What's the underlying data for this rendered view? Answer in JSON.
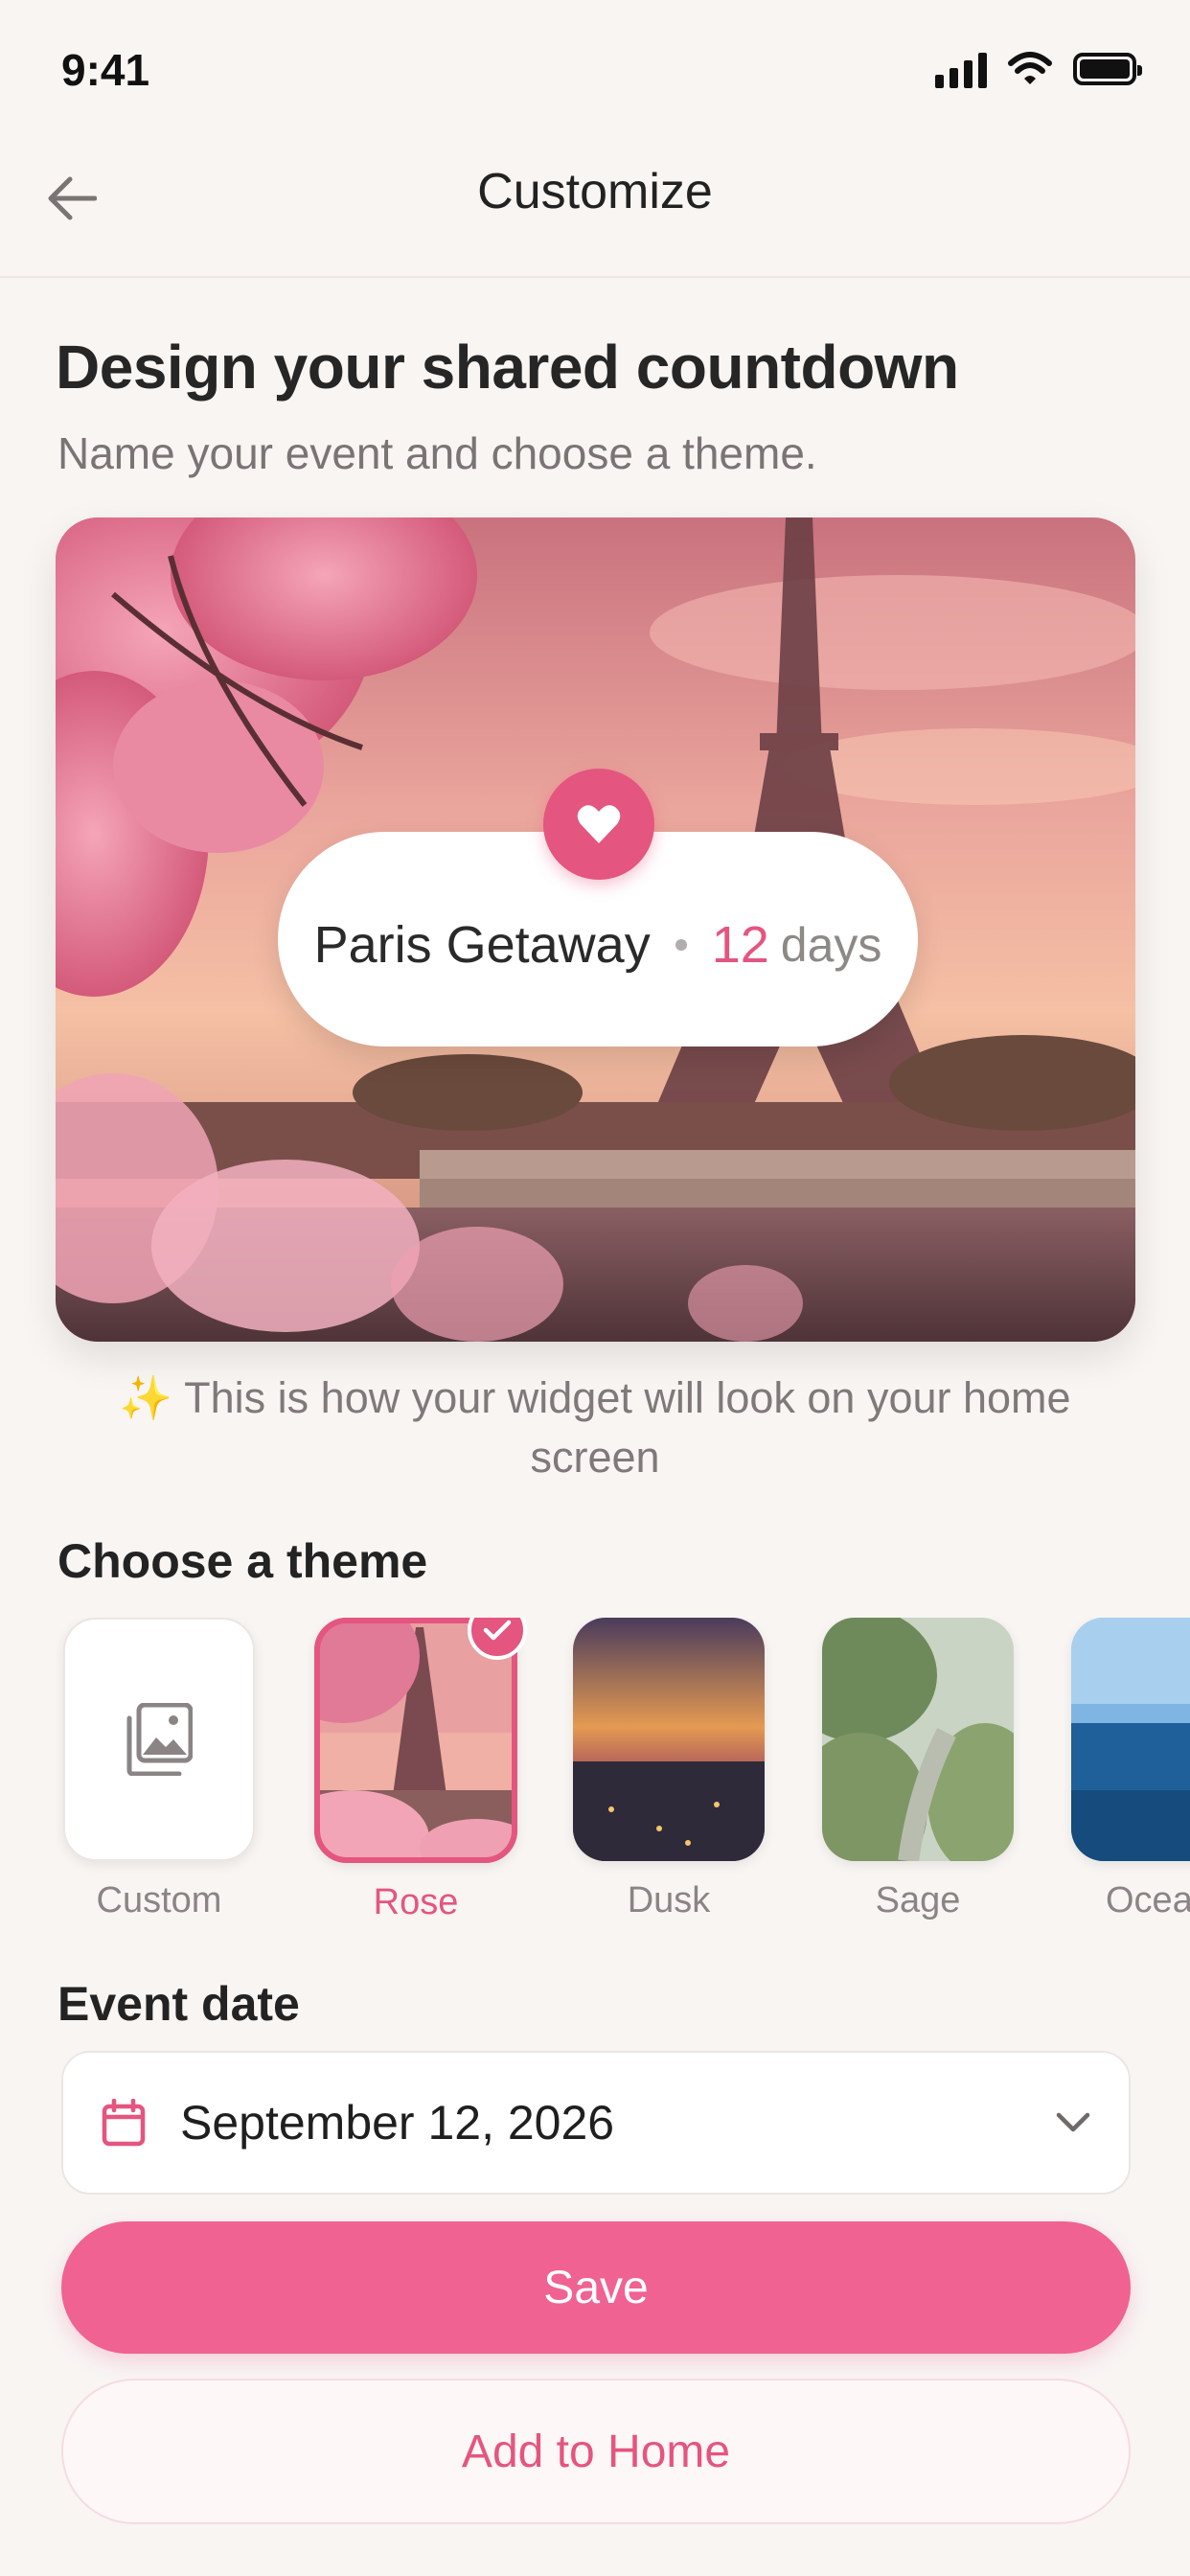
{
  "status_bar": {
    "time": "9:41"
  },
  "nav": {
    "title": "Customize",
    "back_icon": "arrow-left-icon"
  },
  "header": {
    "title": "Design your shared countdown",
    "subtitle": "Name your event and choose a theme."
  },
  "preview": {
    "event_name": "Paris Getaway",
    "separator": "•",
    "count": "12",
    "unit": "days",
    "badge_icon": "heart-icon"
  },
  "hint": {
    "icon": "✨",
    "text": "This is how your widget will look on your home screen"
  },
  "themes": {
    "title": "Choose a theme",
    "selected": "Rose",
    "items": [
      {
        "label": "Custom",
        "icon": "image-gallery-icon"
      },
      {
        "label": "Rose"
      },
      {
        "label": "Dusk"
      },
      {
        "label": "Sage"
      },
      {
        "label": "Ocea"
      }
    ]
  },
  "event_date": {
    "title": "Event date",
    "value": "September 12, 2026",
    "icon": "calendar-icon",
    "dropdown_icon": "chevron-down-icon"
  },
  "actions": {
    "save_label": "Save",
    "add_home_label": "Add to Home"
  },
  "colors": {
    "accent": "#e4557f",
    "button_primary": "#f06292",
    "background": "#f8f5f3"
  }
}
